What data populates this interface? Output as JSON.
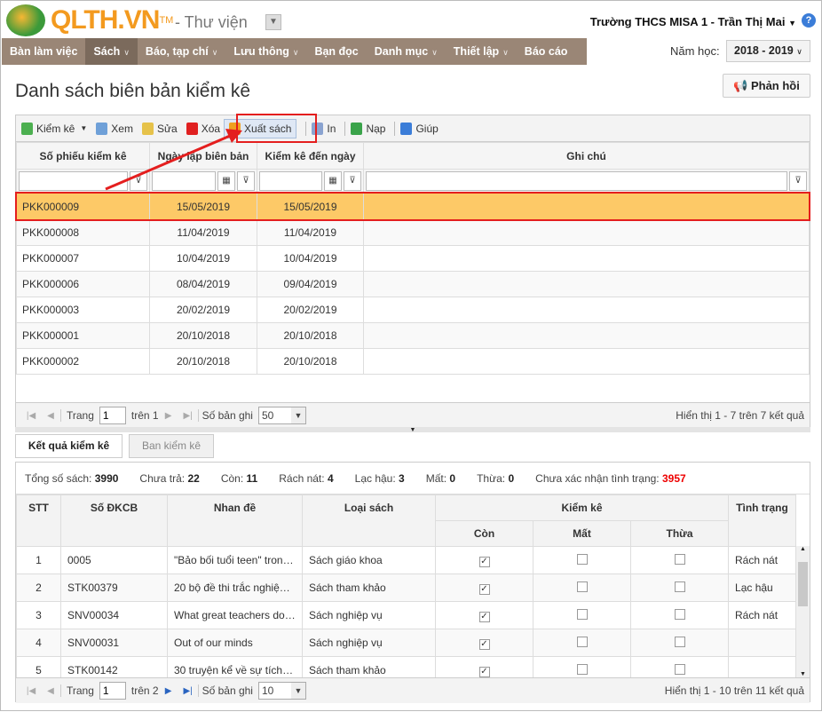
{
  "header": {
    "brand": "QLTH.VN",
    "tm": "TM",
    "module": "- Thư viện",
    "user": "Trường THCS MISA 1 - Trần Thị Mai",
    "year_label": "Năm học:",
    "year": "2018 - 2019"
  },
  "nav": [
    {
      "label": "Bàn làm việc",
      "chev": false
    },
    {
      "label": "Sách",
      "chev": true,
      "active": true
    },
    {
      "label": "Báo, tạp chí",
      "chev": true
    },
    {
      "label": "Lưu thông",
      "chev": true
    },
    {
      "label": "Bạn đọc",
      "chev": false
    },
    {
      "label": "Danh mục",
      "chev": true
    },
    {
      "label": "Thiết lập",
      "chev": true
    },
    {
      "label": "Báo cáo",
      "chev": false
    }
  ],
  "page": {
    "title": "Danh sách biên bản kiểm kê",
    "feedback": "Phản hồi"
  },
  "toolbar": [
    {
      "label": "Kiểm kê",
      "color": "#4caf50",
      "dd": true
    },
    {
      "label": "Xem",
      "color": "#6fa0d8"
    },
    {
      "label": "Sửa",
      "color": "#e6c24a"
    },
    {
      "label": "Xóa",
      "color": "#e02020"
    },
    {
      "label": "Xuất sách",
      "color": "#f0a020",
      "hl": true
    },
    {
      "label": "In",
      "color": "#8aa3d0",
      "sep": true
    },
    {
      "label": "Nạp",
      "color": "#3aa34a",
      "sep": true
    },
    {
      "label": "Giúp",
      "color": "#3b7dd8",
      "sep": true
    }
  ],
  "grid": {
    "columns": [
      "Số phiếu kiểm kê",
      "Ngày lập biên bản",
      "Kiểm kê đến ngày",
      "Ghi chú"
    ],
    "rows": [
      [
        "PKK000009",
        "15/05/2019",
        "15/05/2019",
        ""
      ],
      [
        "PKK000008",
        "11/04/2019",
        "11/04/2019",
        ""
      ],
      [
        "PKK000007",
        "10/04/2019",
        "10/04/2019",
        ""
      ],
      [
        "PKK000006",
        "08/04/2019",
        "09/04/2019",
        ""
      ],
      [
        "PKK000003",
        "20/02/2019",
        "20/02/2019",
        ""
      ],
      [
        "PKK000001",
        "20/10/2018",
        "20/10/2018",
        ""
      ],
      [
        "PKK000002",
        "20/10/2018",
        "20/10/2018",
        ""
      ]
    ],
    "pager": {
      "page_label": "Trang",
      "page": "1",
      "of": "trên 1",
      "size_label": "Số bản ghi",
      "size": "50",
      "info": "Hiển thị 1 - 7 trên 7 kết quả"
    }
  },
  "tabs": [
    "Kết quả kiểm kê",
    "Ban kiểm kê"
  ],
  "summary": [
    {
      "label": "Tổng số sách:",
      "value": "3990"
    },
    {
      "label": "Chưa trả:",
      "value": "22"
    },
    {
      "label": "Còn:",
      "value": "11"
    },
    {
      "label": "Rách nát:",
      "value": "4"
    },
    {
      "label": "Lạc hậu:",
      "value": "3"
    },
    {
      "label": "Mất:",
      "value": "0"
    },
    {
      "label": "Thừa:",
      "value": "0"
    },
    {
      "label": "Chưa xác nhận tình trạng:",
      "value": "3957",
      "red": true
    }
  ],
  "detail": {
    "columns": {
      "stt": "STT",
      "dkcb": "Số ĐKCB",
      "title": "Nhan đề",
      "type": "Loại sách",
      "check": "Kiểm kê",
      "con": "Còn",
      "mat": "Mất",
      "thua": "Thừa",
      "status": "Tình trạng"
    },
    "rows": [
      [
        "1",
        "0005",
        "\"Bảo bối tuổi teen\" trong...",
        "Sách giáo khoa",
        true,
        false,
        false,
        "Rách nát"
      ],
      [
        "2",
        "STK00379",
        "20 bộ đề thi trắc nghiệm...",
        "Sách tham khảo",
        true,
        false,
        false,
        "Lạc hậu"
      ],
      [
        "3",
        "SNV00034",
        "What great teachers do ...",
        "Sách nghiệp vụ",
        true,
        false,
        false,
        "Rách nát"
      ],
      [
        "4",
        "SNV00031",
        "Out of our minds",
        "Sách nghiệp vụ",
        true,
        false,
        false,
        ""
      ],
      [
        "5",
        "STK00142",
        "30 truyện kể về sự tích c...",
        "Sách tham khảo",
        true,
        false,
        false,
        ""
      ]
    ],
    "pager": {
      "page_label": "Trang",
      "page": "1",
      "of": "trên 2",
      "size_label": "Số bản ghi",
      "size": "10",
      "info": "Hiển thị 1 - 10 trên 11 kết quả"
    }
  }
}
